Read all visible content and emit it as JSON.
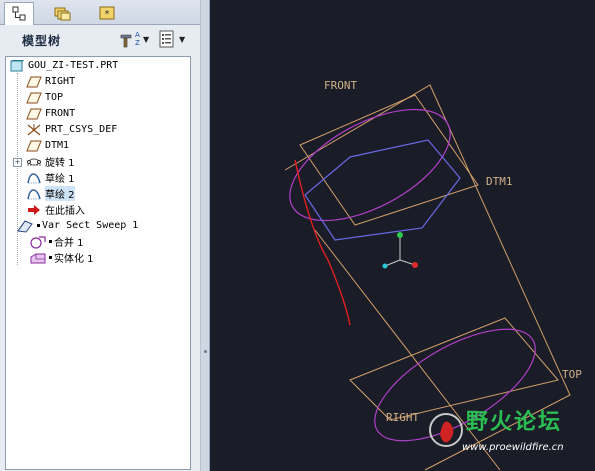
{
  "tabs": [
    {
      "name": "model-tree",
      "icon": "hierarchy-icon",
      "active": true
    },
    {
      "name": "folder-browser",
      "icon": "folders-icon",
      "active": false
    },
    {
      "name": "favorites",
      "icon": "favorites-icon",
      "active": false
    }
  ],
  "panel": {
    "title": "模型树",
    "settings_icon": "tree-settings-icon",
    "filter_icon": "tree-columns-icon"
  },
  "tree": {
    "root": "GOU_ZI-TEST.PRT",
    "items": [
      {
        "label": "RIGHT",
        "icon": "datum-plane-icon"
      },
      {
        "label": "TOP",
        "icon": "datum-plane-icon"
      },
      {
        "label": "FRONT",
        "icon": "datum-plane-icon"
      },
      {
        "label": "PRT_CSYS_DEF",
        "icon": "coordinate-system-icon"
      },
      {
        "label": "DTM1",
        "icon": "datum-plane-icon"
      },
      {
        "label": "旋转 1",
        "icon": "revolve-icon",
        "expandable": true
      },
      {
        "label": "草绘 1",
        "icon": "sketch-icon"
      },
      {
        "label": "草绘 2",
        "icon": "sketch-icon",
        "selected": true
      },
      {
        "label": "在此插入",
        "icon": "insert-here-arrow-icon"
      },
      {
        "label": "Var Sect Sweep 1",
        "icon": "var-sect-sweep-icon"
      },
      {
        "label": "合并 1",
        "icon": "merge-icon"
      },
      {
        "label": "实体化 1",
        "icon": "solidify-icon"
      }
    ]
  },
  "viewport": {
    "datum_labels": {
      "front": "FRONT",
      "dtm1": "DTM1",
      "top": "TOP",
      "right": "RIGHT"
    },
    "colors": {
      "background": "#1a1c28",
      "datum": "#d2a06a",
      "sketch": "#b040c8",
      "surface": "#6a6ae6",
      "trajectory": "#e02020"
    }
  },
  "watermark": {
    "text": "野火论坛",
    "url": "www.proewildfire.cn"
  }
}
